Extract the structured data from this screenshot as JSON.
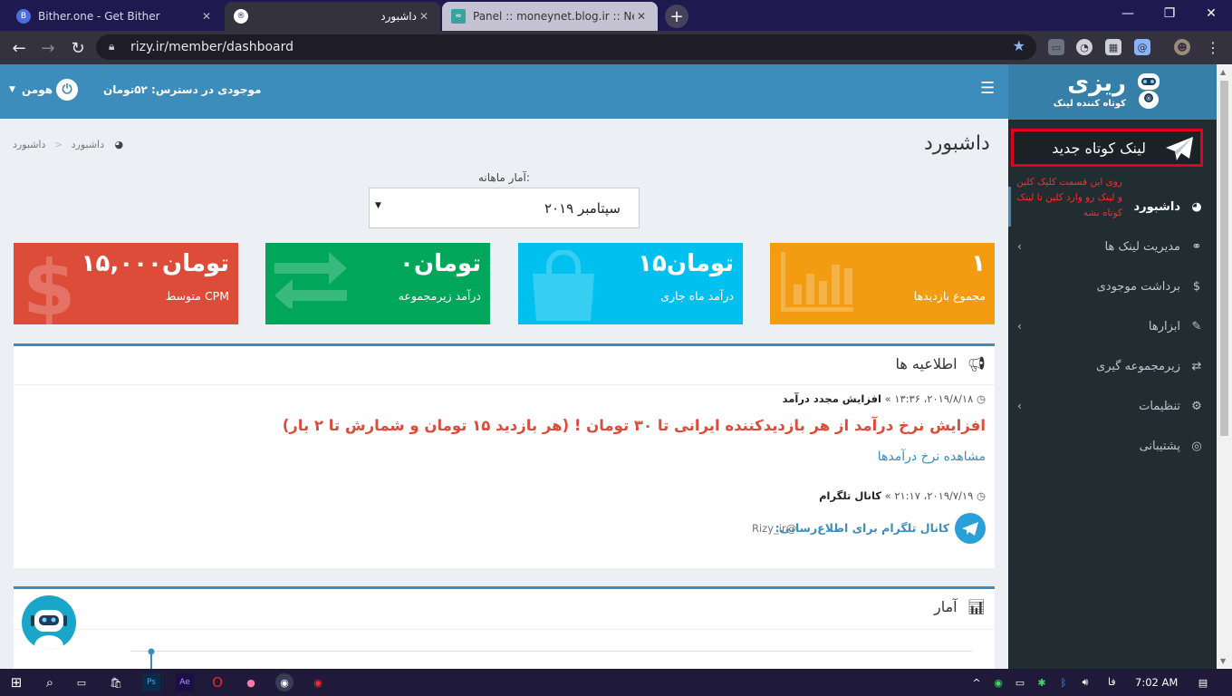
{
  "browser": {
    "tabs": [
      {
        "title": "Bither.one - Get Bither",
        "favicon": "B"
      },
      {
        "title": "داشبورد",
        "favicon": "®"
      },
      {
        "title": "Panel :: moneynet.blog.ir :: New P",
        "favicon": "≈"
      }
    ],
    "url": "rizy.ir/member/dashboard"
  },
  "brand": {
    "name": "ریزی",
    "tagline": "کوتاه کننده لینک"
  },
  "sidebar": {
    "new_link": "لینک کوتاه جدید",
    "annotation": "روی این قسمت کلیک کلین و لینک رو وارد کلین تا لینک کوتاه بشه",
    "items": [
      {
        "label": "داشبورد",
        "icon": "dashboard-icon",
        "active": true
      },
      {
        "label": "مدیریت لینک ها",
        "icon": "link-icon"
      },
      {
        "label": "برداشت موجودی",
        "icon": "dollar-icon"
      },
      {
        "label": "ابزارها",
        "icon": "wrench-icon"
      },
      {
        "label": "زیرمجموعه گیری",
        "icon": "exchange-icon"
      },
      {
        "label": "تنظیمات",
        "icon": "gears-icon"
      },
      {
        "label": "پشتیبانی",
        "icon": "lifebuoy-icon"
      }
    ]
  },
  "header": {
    "balance": "موجودی در دسترس: ۵۲تومان",
    "user": "هومن"
  },
  "page": {
    "title": "داشبورد",
    "breadcrumb": [
      "داشبورد",
      "داشبورد"
    ],
    "stats_label": "آمار ماهانه:",
    "month_selected": "سپتامبر ۲۰۱۹"
  },
  "stat_boxes": [
    {
      "value": "۱",
      "label": "مجموع بازدیدها",
      "color": "#f39c12",
      "icon": "bar-chart-icon"
    },
    {
      "value": "۱۵تومان",
      "label": "درآمد ماه جاری",
      "color": "#00c0ef",
      "icon": "shopping-bag-icon"
    },
    {
      "value": "۰تومان",
      "label": "درآمد زیرمجموعه",
      "color": "#00a65a",
      "icon": "exchange-icon"
    },
    {
      "value": "۱۵,۰۰۰تومان",
      "label": "متوسط CPM",
      "color": "#dd4b39",
      "icon": "dollar-icon"
    }
  ],
  "announcements": {
    "heading": "اطلاعیه ها",
    "items": [
      {
        "title": "افزایش مجدد درآمد",
        "date": "۲۰۱۹/۸/۱۸، ۱۳:۳۶",
        "headline": "افزایش نرخ درآمد از هر بازدیدکننده ایرانی تا ۳۰ تومان ! (هر بازدید ۱۵ تومان و شمارش تا ۲ بار)",
        "link": "مشاهده نرخ درآمدها"
      },
      {
        "title": "کانال تلگرام",
        "date": "۲۰۱۹/۷/۱۹، ۲۱:۱۷",
        "text": "کانال تلگرام برای اطلاع‌رسانی:",
        "handle": "Rizy_ir@"
      }
    ]
  },
  "stats_panel": {
    "heading": "آمار"
  },
  "taskbar": {
    "time": "7:02 AM",
    "lang": "فا"
  }
}
